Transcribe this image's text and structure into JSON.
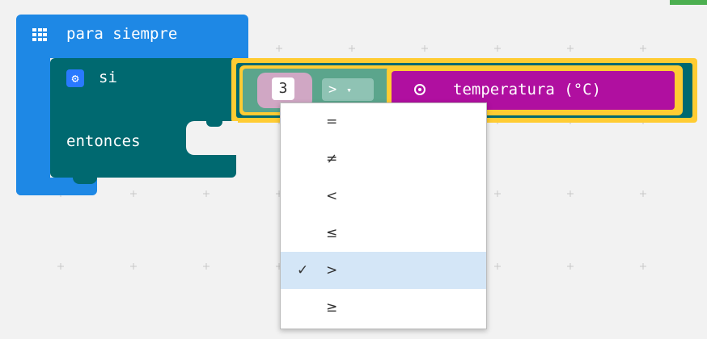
{
  "forever_block": {
    "label": "para siempre",
    "icon": "grid-icon"
  },
  "if_block": {
    "if_label": "si",
    "then_label": "entonces",
    "icon": "gear-icon"
  },
  "condition": {
    "left_value": "3",
    "operator": ">",
    "operator_arrow": "▾",
    "sensor_label": "temperatura (°C)",
    "sensor_icon": "target-icon"
  },
  "dropdown": {
    "items": [
      {
        "symbol": "=",
        "checked": ""
      },
      {
        "symbol": "≠",
        "checked": ""
      },
      {
        "symbol": "<",
        "checked": ""
      },
      {
        "symbol": "≤",
        "checked": ""
      },
      {
        "symbol": ">",
        "checked": "✓"
      },
      {
        "symbol": "≥",
        "checked": ""
      }
    ],
    "selected": ">"
  },
  "colors": {
    "forever": "#1e88e5",
    "logic": "#006970",
    "input": "#b00fa0",
    "highlight": "#ffcc33"
  }
}
